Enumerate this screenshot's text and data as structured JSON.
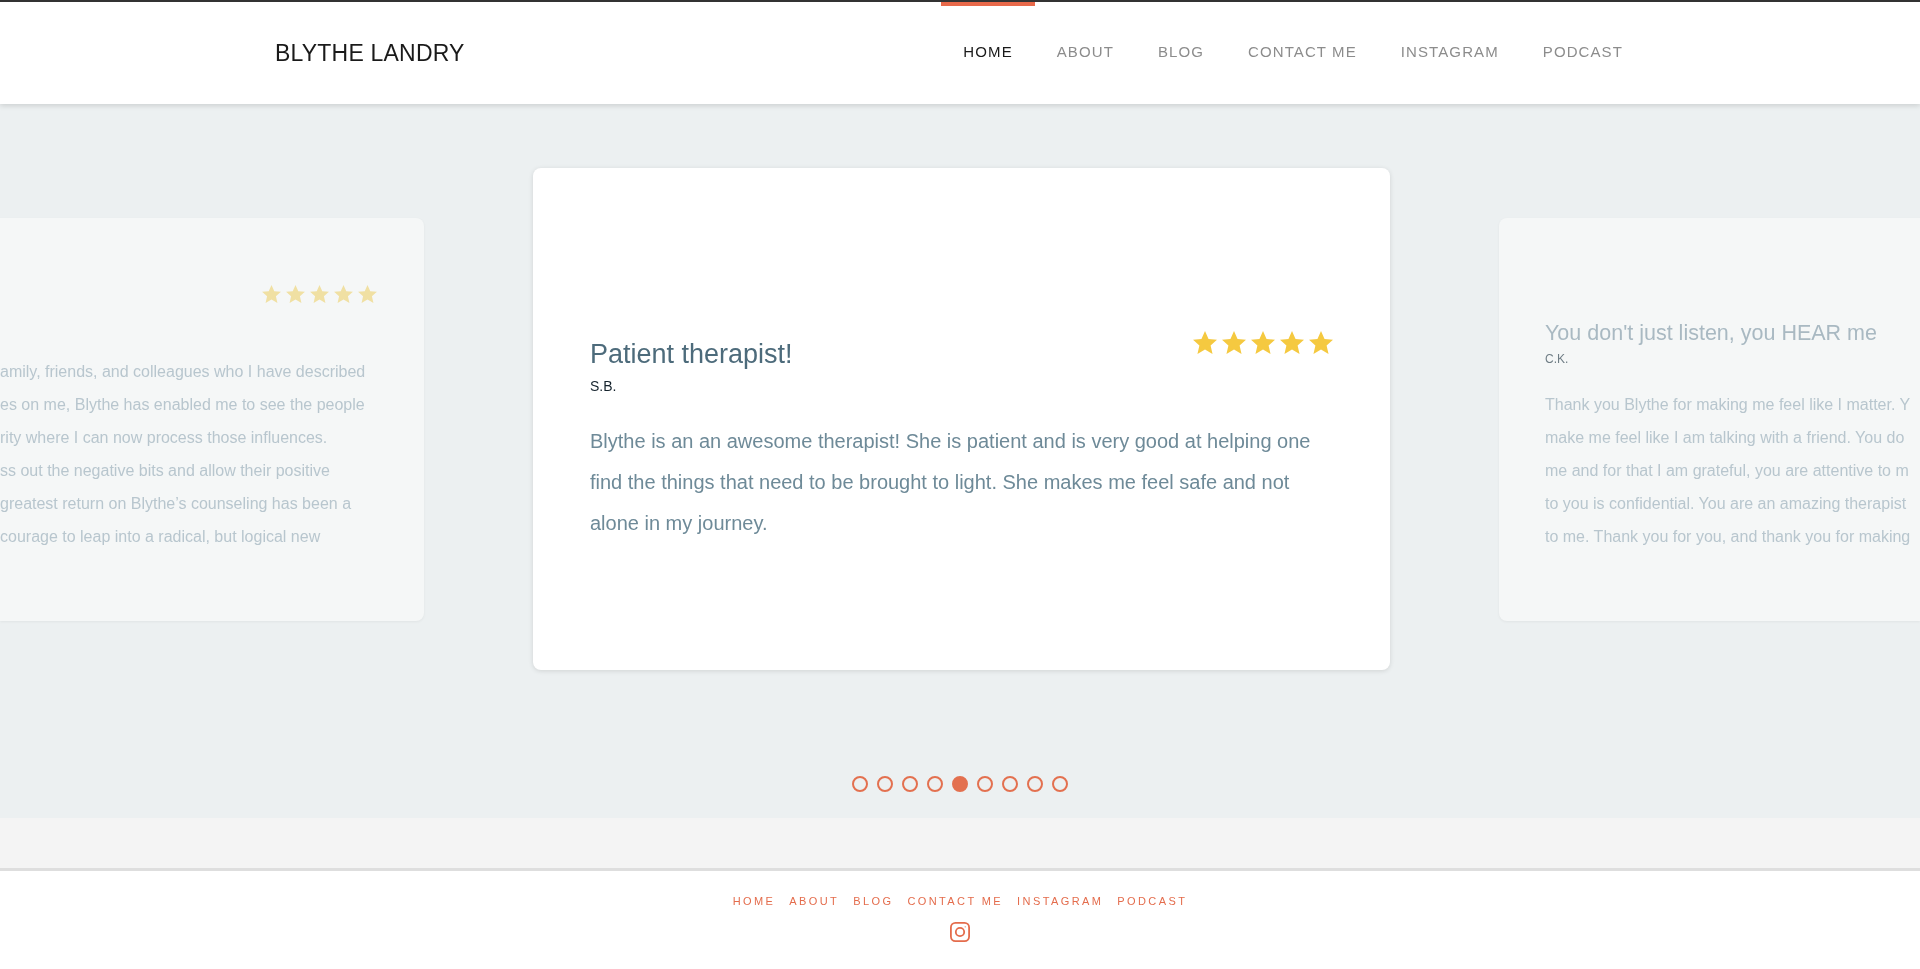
{
  "header": {
    "logo": "BLYTHE LANDRY",
    "nav": [
      {
        "label": "HOME",
        "selected": true
      },
      {
        "label": "ABOUT",
        "selected": false
      },
      {
        "label": "BLOG",
        "selected": false
      },
      {
        "label": "CONTACT ME",
        "selected": false
      },
      {
        "label": "INSTAGRAM",
        "selected": false
      },
      {
        "label": "PODCAST",
        "selected": false
      }
    ]
  },
  "testimonials": {
    "cards": [
      {
        "selected": false,
        "stars": 5,
        "body_lines": [
          "amily, friends, and colleagues who I have described",
          "es on me, Blythe has enabled me to see the people",
          "rity where I can now process those influences.",
          "ss out the negative bits and allow their positive",
          "greatest return on Blythe’s counseling has been a",
          "courage to leap into a radical, but logical new"
        ]
      },
      {
        "selected": true,
        "title": "Patient therapist!",
        "author": "S.B.",
        "stars": 5,
        "body": "Blythe is an an awesome therapist! She is patient and is very good at helping one find the things that need to be brought to light. She makes me feel safe and not alone in my journey."
      },
      {
        "selected": false,
        "title": "You don't just listen, you HEAR me",
        "author": "C.K.",
        "body_lines": [
          "Thank you Blythe for making me feel like I matter. Y",
          "make me feel like I am talking with a friend. You do",
          "me and for that I am grateful, you are attentive to m",
          "to you is confidential. You are an amazing therapist",
          "to me. Thank you for you, and thank you for making"
        ]
      }
    ],
    "dots": [
      {
        "selected": false
      },
      {
        "selected": false
      },
      {
        "selected": false
      },
      {
        "selected": false
      },
      {
        "selected": true
      },
      {
        "selected": false
      },
      {
        "selected": false
      },
      {
        "selected": false
      },
      {
        "selected": false
      }
    ]
  },
  "footer": {
    "links": [
      "HOME",
      "ABOUT",
      "BLOG",
      "CONTACT ME",
      "INSTAGRAM",
      "PODCAST"
    ]
  }
}
